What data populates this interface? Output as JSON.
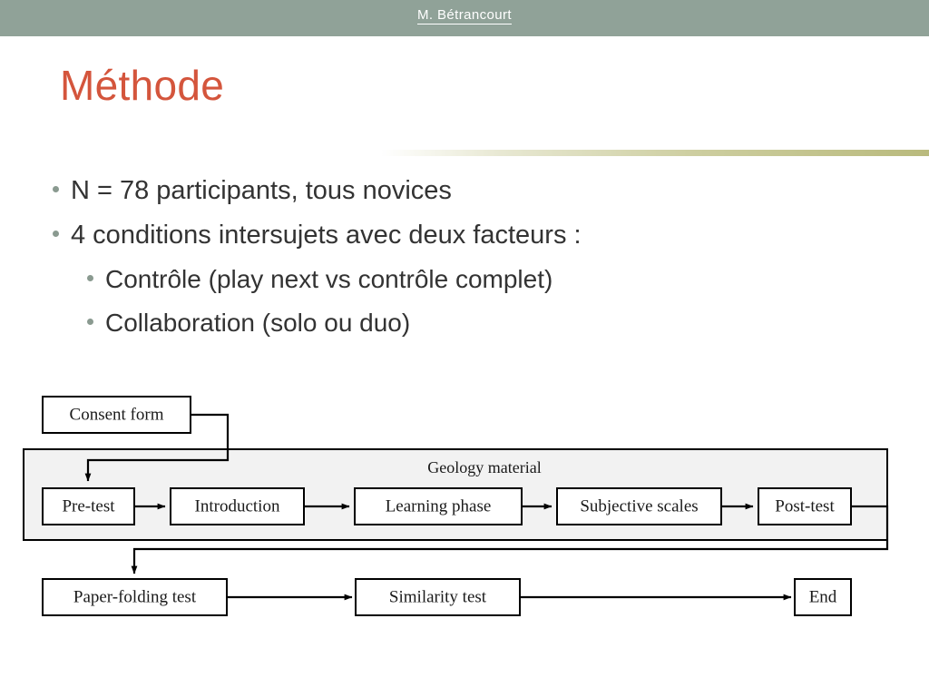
{
  "header": {
    "author": "M. Bétrancourt",
    "bar_color": "#90a298"
  },
  "slide": {
    "title": "Méthode",
    "title_color": "#d4553c",
    "rule_color": "#b9ba7d",
    "bullet_color": "#8a9a90"
  },
  "bullets": [
    {
      "level": 1,
      "text": "N = 78 participants, tous novices"
    },
    {
      "level": 1,
      "text": "4 conditions intersujets avec deux facteurs :"
    },
    {
      "level": 2,
      "text": "Contrôle (play next vs contrôle complet)"
    },
    {
      "level": 2,
      "text": "Collaboration (solo ou duo)"
    }
  ],
  "diagram": {
    "band_label": "Geology material",
    "band_fill": "#f2f2f2",
    "boxes": {
      "consent": "Consent form",
      "pretest": "Pre-test",
      "introduction": "Introduction",
      "learning": "Learning phase",
      "subjective": "Subjective scales",
      "posttest": "Post-test",
      "paperfolding": "Paper-folding test",
      "similarity": "Similarity test",
      "end": "End"
    }
  }
}
